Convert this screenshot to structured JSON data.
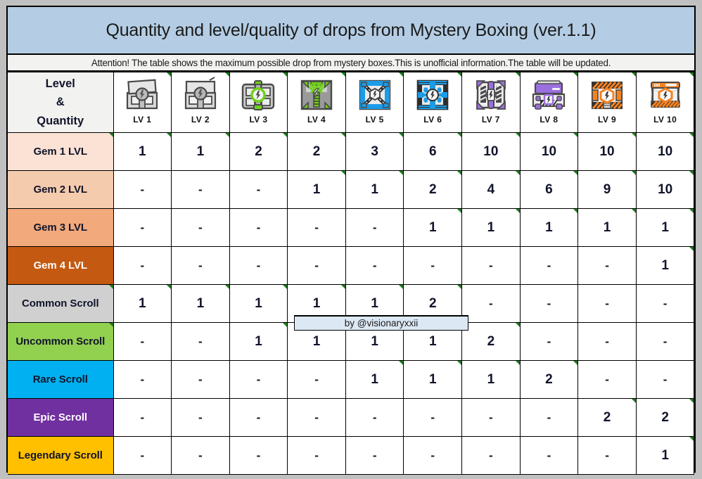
{
  "title": "Quantity and level/quality of drops from Mystery Boxing (ver.1.1)",
  "subtitle": "Attention! The table shows the maximum possible drop from mystery boxes.This is unofficial information.The table will be updated.",
  "watermark": "by @visionaryxxii",
  "corner_header": {
    "line1": "Level",
    "line2": "&",
    "line3": "Quantity"
  },
  "colors": {
    "title_bg": "#b4cde4",
    "subtitle_bg": "#f2f2f0",
    "page_bg": "#c0c0c0",
    "watermark_bg": "#dce8f4",
    "gem1": "#fbe2d5",
    "gem2": "#f5cbad",
    "gem3": "#f2a97c",
    "gem4": "#c45911",
    "common": "#d0d0d0",
    "uncommon": "#92d050",
    "rare": "#00b0f0",
    "epic": "#7030a0",
    "legendary": "#ffc000",
    "flag_green": "#1f7a1f"
  },
  "columns": [
    {
      "label": "LV 1",
      "icon": "mystery-box-lv1-icon",
      "tier": "grey"
    },
    {
      "label": "LV 2",
      "icon": "mystery-box-lv2-icon",
      "tier": "grey"
    },
    {
      "label": "LV 3",
      "icon": "mystery-box-lv3-icon",
      "tier": "grey-green"
    },
    {
      "label": "LV 4",
      "icon": "mystery-box-lv4-icon",
      "tier": "green"
    },
    {
      "label": "LV 5",
      "icon": "mystery-box-lv5-icon",
      "tier": "blue"
    },
    {
      "label": "LV 6",
      "icon": "mystery-box-lv6-icon",
      "tier": "blue"
    },
    {
      "label": "LV 7",
      "icon": "mystery-box-lv7-icon",
      "tier": "purple"
    },
    {
      "label": "LV 8",
      "icon": "mystery-box-lv8-icon",
      "tier": "purple"
    },
    {
      "label": "LV 9",
      "icon": "mystery-box-lv9-icon",
      "tier": "orange"
    },
    {
      "label": "LV 10",
      "icon": "mystery-box-lv10-icon",
      "tier": "orange"
    }
  ],
  "rows": [
    {
      "label": "Gem 1 LVL",
      "bg": "#fbe2d5",
      "fg": "#11142b",
      "values": [
        "1",
        "1",
        "2",
        "2",
        "3",
        "6",
        "10",
        "10",
        "10",
        "10"
      ]
    },
    {
      "label": "Gem 2 LVL",
      "bg": "#f5cbad",
      "fg": "#11142b",
      "values": [
        "-",
        "-",
        "-",
        "1",
        "1",
        "2",
        "4",
        "6",
        "9",
        "10"
      ]
    },
    {
      "label": "Gem 3 LVL",
      "bg": "#f2a97c",
      "fg": "#11142b",
      "values": [
        "-",
        "-",
        "-",
        "-",
        "-",
        "1",
        "1",
        "1",
        "1",
        "1"
      ]
    },
    {
      "label": "Gem 4 LVL",
      "bg": "#c45911",
      "fg": "#ffffff",
      "values": [
        "-",
        "-",
        "-",
        "-",
        "-",
        "-",
        "-",
        "-",
        "-",
        "1"
      ]
    },
    {
      "label": "Common Scroll",
      "bg": "#d0d0d0",
      "fg": "#11142b",
      "values": [
        "1",
        "1",
        "1",
        "1",
        "1",
        "2",
        "-",
        "-",
        "-",
        "-"
      ]
    },
    {
      "label": "Uncommon Scroll",
      "bg": "#92d050",
      "fg": "#11142b",
      "values": [
        "-",
        "-",
        "1",
        "1",
        "1",
        "1",
        "2",
        "-",
        "-",
        "-"
      ]
    },
    {
      "label": "Rare Scroll",
      "bg": "#00b0f0",
      "fg": "#11142b",
      "values": [
        "-",
        "-",
        "-",
        "-",
        "1",
        "1",
        "1",
        "2",
        "-",
        "-"
      ]
    },
    {
      "label": "Epic Scroll",
      "bg": "#7030a0",
      "fg": "#ffffff",
      "values": [
        "-",
        "-",
        "-",
        "-",
        "-",
        "-",
        "-",
        "-",
        "2",
        "2"
      ]
    },
    {
      "label": "Legendary Scroll",
      "bg": "#ffc000",
      "fg": "#11142b",
      "values": [
        "-",
        "-",
        "-",
        "-",
        "-",
        "-",
        "-",
        "-",
        "-",
        "1"
      ]
    }
  ]
}
